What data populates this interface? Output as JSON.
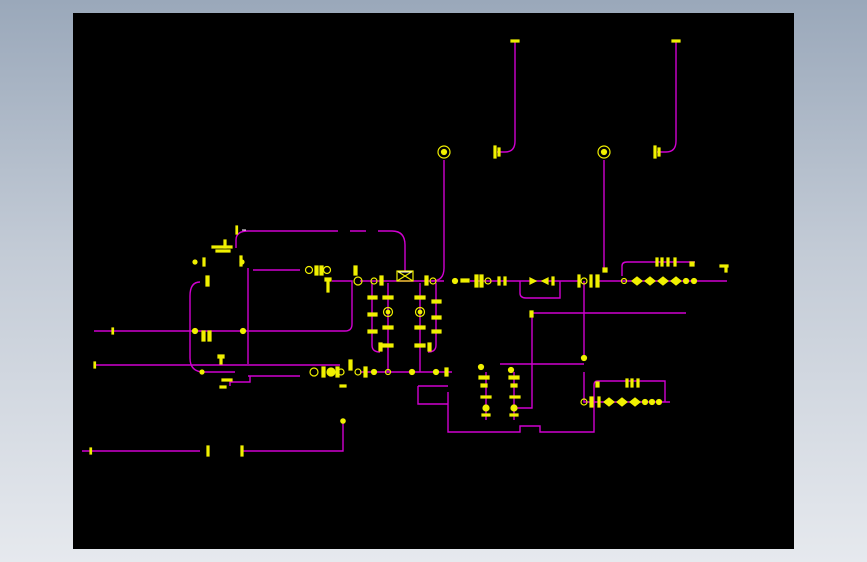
{
  "viewer": {
    "background": "#000000",
    "line_color": "#d000d0",
    "symbol_color": "#f0f000",
    "accent_white": "#ffffff"
  },
  "drawing": {
    "type": "piping schematic (P&ID)",
    "icons": [
      "valve-icon",
      "flange-icon",
      "gauge-icon",
      "reducer-icon",
      "check-valve-icon",
      "cap-icon"
    ]
  }
}
